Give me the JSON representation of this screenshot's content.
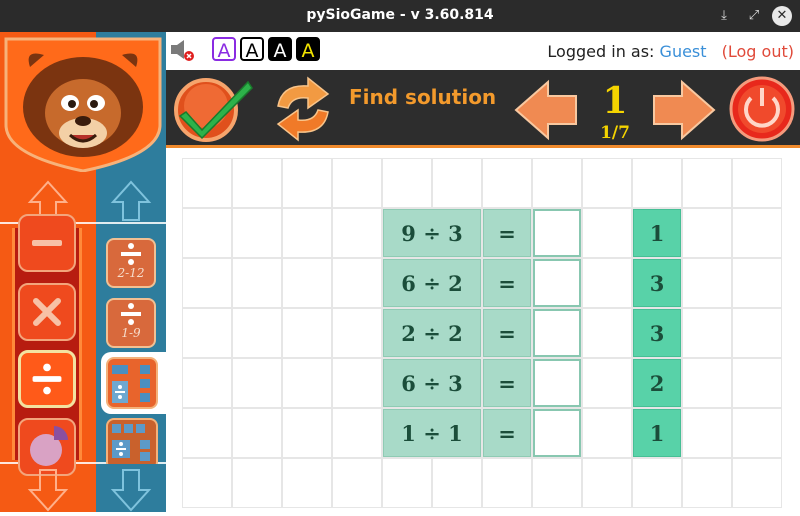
{
  "window": {
    "title": "pySioGame - v 3.60.814",
    "buttons": [
      "minimize",
      "maximize",
      "close"
    ]
  },
  "toolbar": {
    "font_buttons": [
      "A",
      "A",
      "A",
      "A"
    ],
    "logged_in_label": "Logged in as:",
    "user": "Guest",
    "logout": "(Log out)"
  },
  "actions": {
    "find_solution": "Find solution",
    "level": "1",
    "level_progress": "1/7"
  },
  "sub_categories": [
    {
      "label": "2-12"
    },
    {
      "label": "1-9"
    }
  ],
  "puzzle": {
    "equals_sign": "=",
    "rows": [
      {
        "expression": "9 ÷ 3",
        "answer": "",
        "option": "1"
      },
      {
        "expression": "6 ÷ 2",
        "answer": "",
        "option": "3"
      },
      {
        "expression": "2 ÷ 2",
        "answer": "",
        "option": "3"
      },
      {
        "expression": "6 ÷ 3",
        "answer": "",
        "option": "2"
      },
      {
        "expression": "1 ÷ 1",
        "answer": "",
        "option": "1"
      }
    ]
  },
  "colors": {
    "orange": "#f55a14",
    "teal": "#2e7d9d",
    "dark_bar": "#2d2d2d",
    "accent_yellow": "#f5d400",
    "accent_orange": "#f39a2c",
    "task_cell": "#a8dac8",
    "option_cell": "#58d2a8"
  }
}
